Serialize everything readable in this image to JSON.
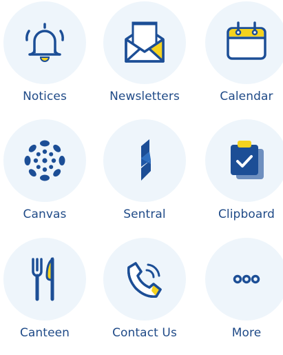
{
  "menu": {
    "items": [
      {
        "label": "Notices",
        "icon": "bell-icon"
      },
      {
        "label": "Newsletters",
        "icon": "envelope-icon"
      },
      {
        "label": "Calendar",
        "icon": "calendar-icon"
      },
      {
        "label": "Canvas",
        "icon": "canvas-logo-icon"
      },
      {
        "label": "Sentral",
        "icon": "sentral-logo-icon"
      },
      {
        "label": "Clipboard",
        "icon": "clipboard-icon"
      },
      {
        "label": "Canteen",
        "icon": "fork-knife-icon"
      },
      {
        "label": "Contact Us",
        "icon": "phone-icon"
      },
      {
        "label": "More",
        "icon": "more-dots-icon"
      }
    ]
  },
  "colors": {
    "navy": "#1c4e96",
    "yellow": "#f5d21e",
    "circle_bg": "#eef5fb",
    "label": "#1f4a87"
  }
}
